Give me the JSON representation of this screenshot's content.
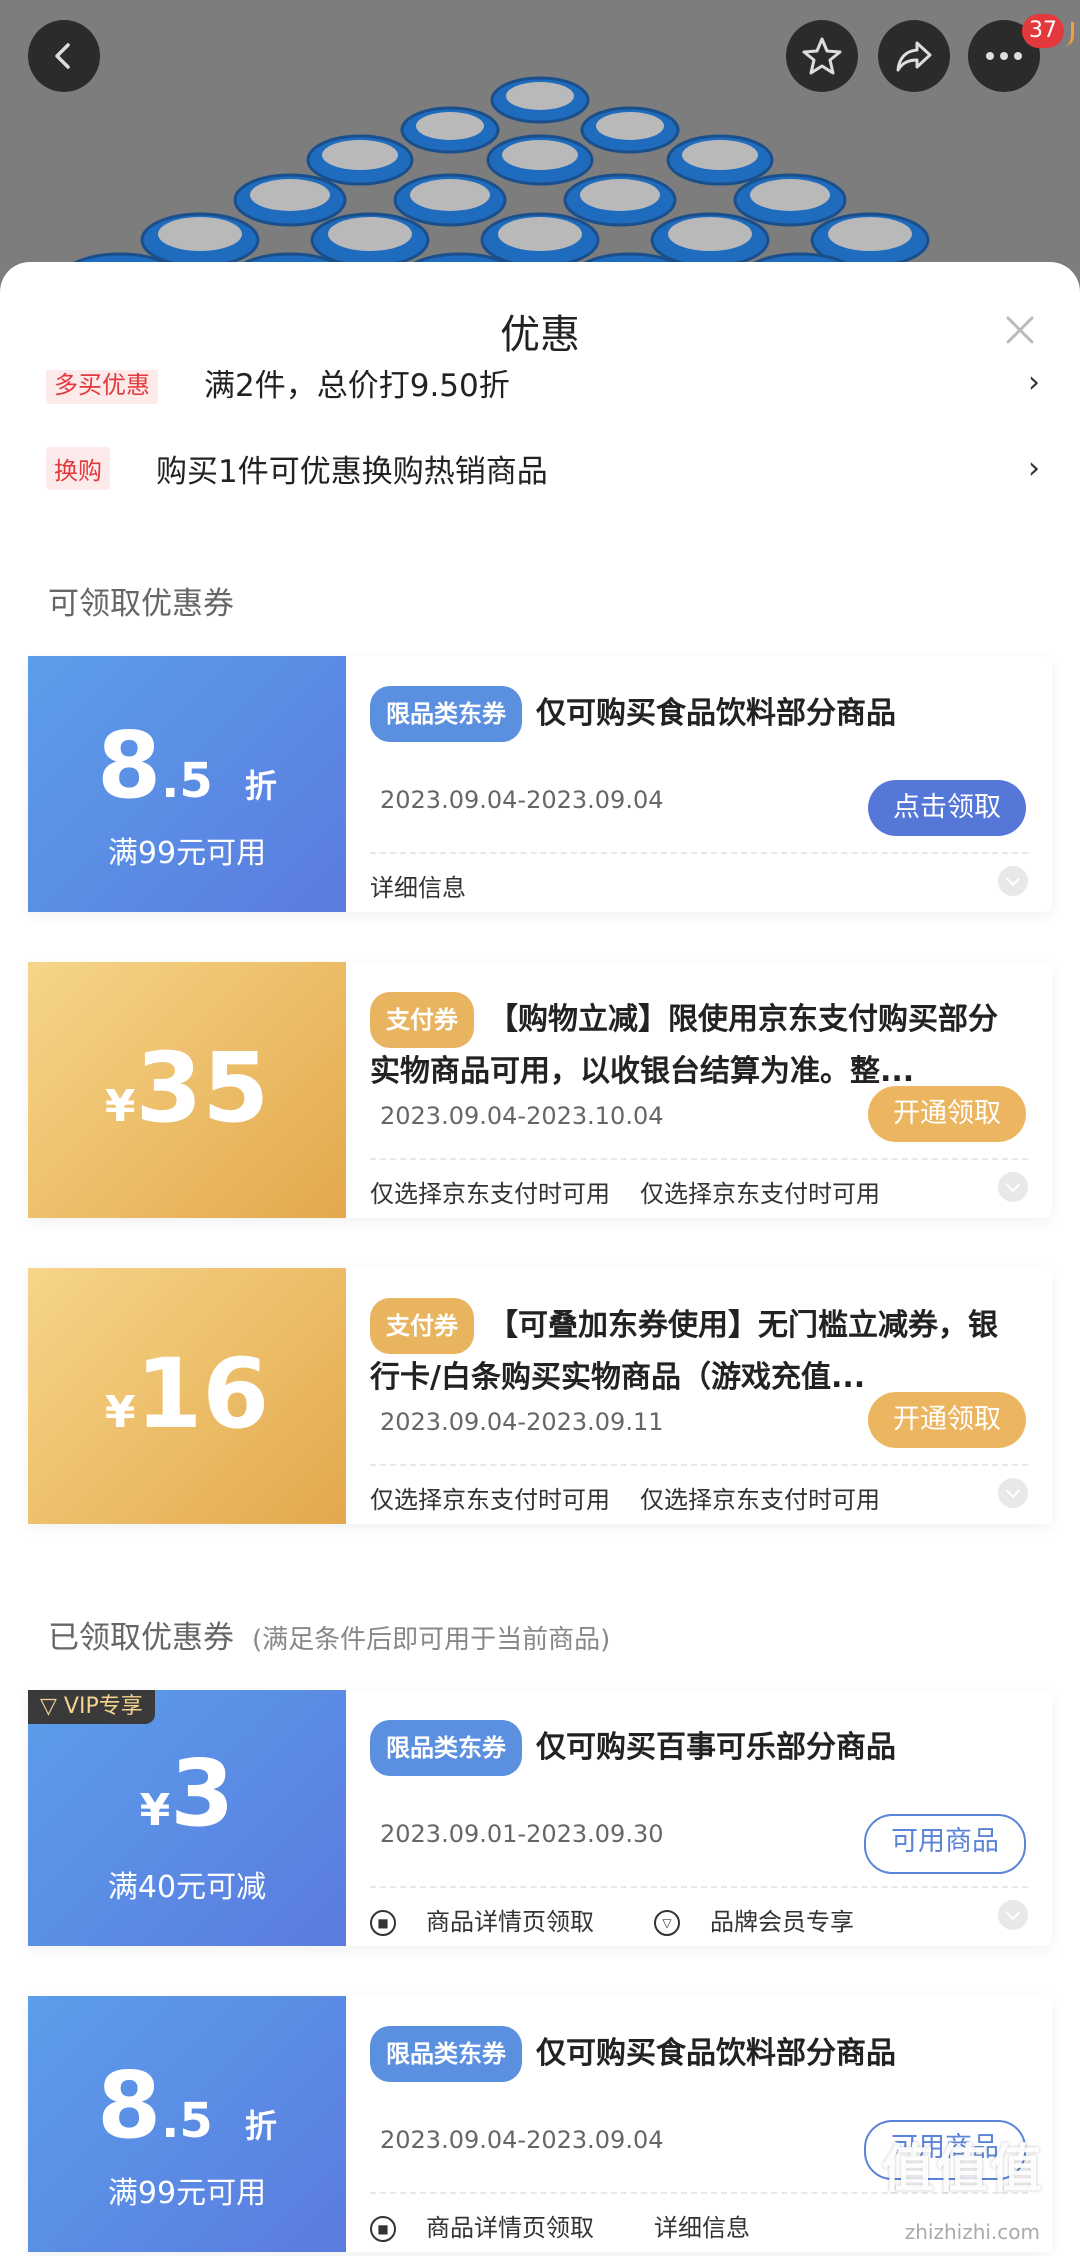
{
  "header": {
    "badge_count": "37",
    "back_icon": "chevron-left-icon",
    "favorite_icon": "star-icon",
    "share_icon": "share-icon",
    "more_icon": "more-dots-icon"
  },
  "sheet": {
    "title": "优惠",
    "promos": [
      {
        "tag": "多买优惠",
        "text": "满2件，总价打9.50折"
      },
      {
        "tag": "换购",
        "text": "购买1件可优惠换购热销商品"
      }
    ]
  },
  "available_section": {
    "title": "可领取优惠券"
  },
  "available_coupons": [
    {
      "amount_main": "8",
      "amount_small": ".5",
      "amount_unit": "折",
      "condition": "满99元可用",
      "type": "限品类东券",
      "title": "仅可购买食品饮料部分商品",
      "date": "2023.09.04-2023.09.04",
      "action": "点击领取",
      "info": [
        "详细信息"
      ]
    },
    {
      "amount_prefix": "¥",
      "amount_main": "35",
      "type": "支付券",
      "title": "【购物立减】限使用京东支付购买部分实物商品可用，以收银台结算为准。整...",
      "date": "2023.09.04-2023.10.04",
      "action": "开通领取",
      "info": [
        "仅选择京东支付时可用",
        "仅选择京东支付时可用"
      ]
    },
    {
      "amount_prefix": "¥",
      "amount_main": "16",
      "type": "支付券",
      "title": "【可叠加东券使用】无门槛立减券，银行卡/白条购买实物商品（游戏充值...",
      "date": "2023.09.04-2023.09.11",
      "action": "开通领取",
      "info": [
        "仅选择京东支付时可用",
        "仅选择京东支付时可用"
      ]
    }
  ],
  "claimed_section": {
    "title": "已领取优惠券",
    "note": "(满足条件后即可用于当前商品)"
  },
  "claimed_coupons": [
    {
      "vip": "VIP专享",
      "amount_prefix": "¥",
      "amount_main": "3",
      "condition": "满40元可减",
      "type": "限品类东券",
      "title": "仅可购买百事可乐部分商品",
      "date": "2023.09.01-2023.09.30",
      "action": "可用商品",
      "info": [
        "商品详情页领取",
        "品牌会员专享"
      ]
    },
    {
      "amount_main": "8",
      "amount_small": ".5",
      "amount_unit": "折",
      "condition": "满99元可用",
      "type": "限品类东券",
      "title": "仅可购买食品饮料部分商品",
      "date": "2023.09.04-2023.09.04",
      "action": "可用商品",
      "info": [
        "商品详情页领取",
        "详细信息"
      ]
    }
  ],
  "watermark": {
    "text": "值值值",
    "url": "zhizhizhi.com"
  },
  "colors": {
    "blue": "#5b8fe0",
    "gold": "#e8b460",
    "red": "#e4393c"
  }
}
